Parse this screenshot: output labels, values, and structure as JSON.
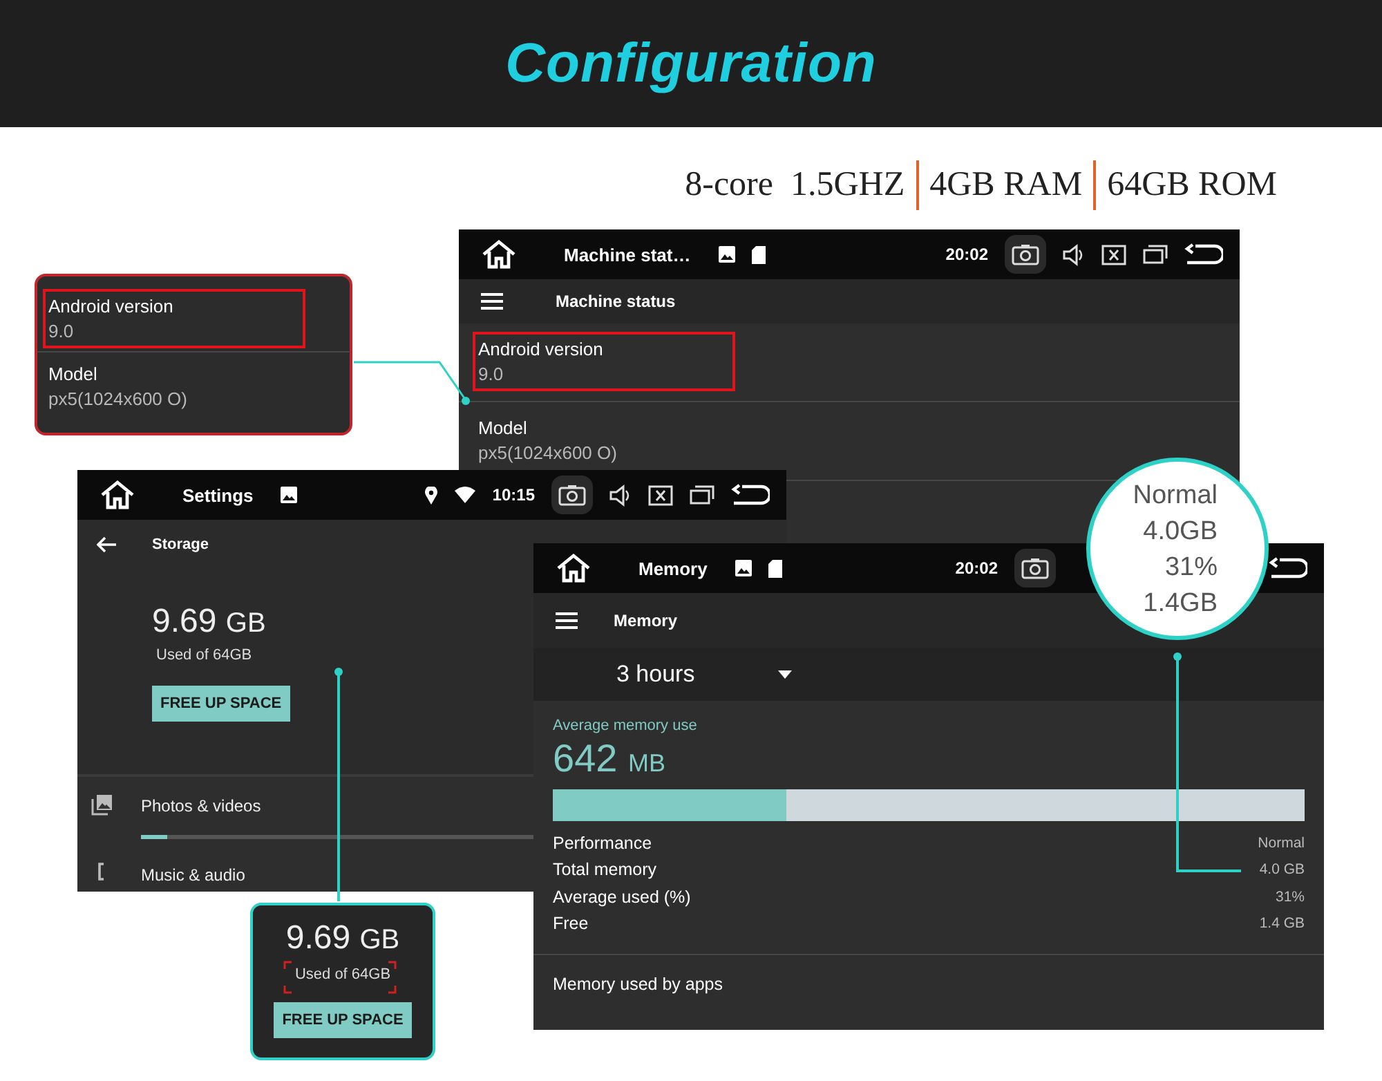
{
  "header": {
    "title": "Configuration"
  },
  "specs": [
    "8-core  1.5GHZ",
    "4GB RAM",
    "64GB ROM"
  ],
  "machine_window": {
    "status_bar": {
      "title": "Machine stat…",
      "time": "20:02"
    },
    "toolbar_title": "Machine status",
    "rows": [
      {
        "label": "Android version",
        "value": "9.0",
        "highlighted": true
      },
      {
        "label": "Model",
        "value": "px5(1024x600 O)",
        "highlighted": false
      }
    ]
  },
  "version_callout": {
    "rows": [
      {
        "label": "Android version",
        "value": "9.0",
        "highlighted": true
      },
      {
        "label": "Model",
        "value": "px5(1024x600 O)",
        "highlighted": false
      }
    ]
  },
  "settings_window": {
    "status_bar": {
      "title": "Settings",
      "time": "10:15"
    },
    "toolbar_title": "Storage",
    "used": "9.69",
    "unit": "GB",
    "used_of": "Used of 64GB",
    "button": "FREE UP SPACE",
    "categories": [
      {
        "label": "Photos & videos",
        "level": 0.04
      },
      {
        "label": "Music & audio"
      }
    ]
  },
  "storage_callout": {
    "used": "9.69",
    "unit": "GB",
    "used_of": "Used of 64GB",
    "button": "FREE UP SPACE"
  },
  "memory_window": {
    "status_bar": {
      "title": "Memory",
      "time": "20:02"
    },
    "toolbar_title": "Memory",
    "period": "3 hours",
    "average_label": "Average memory use",
    "average_value": "642",
    "average_unit": "MB",
    "level": 0.31,
    "stats": [
      {
        "label": "Performance",
        "value": "Normal"
      },
      {
        "label": "Total memory",
        "value": "4.0 GB"
      },
      {
        "label": "Average used (%)",
        "value": "31%"
      },
      {
        "label": "Free",
        "value": "1.4 GB"
      }
    ],
    "apps_heading": "Memory used by apps"
  },
  "memory_callout": {
    "values": [
      "Normal",
      "4.0GB",
      "31%",
      "1.4GB"
    ]
  }
}
